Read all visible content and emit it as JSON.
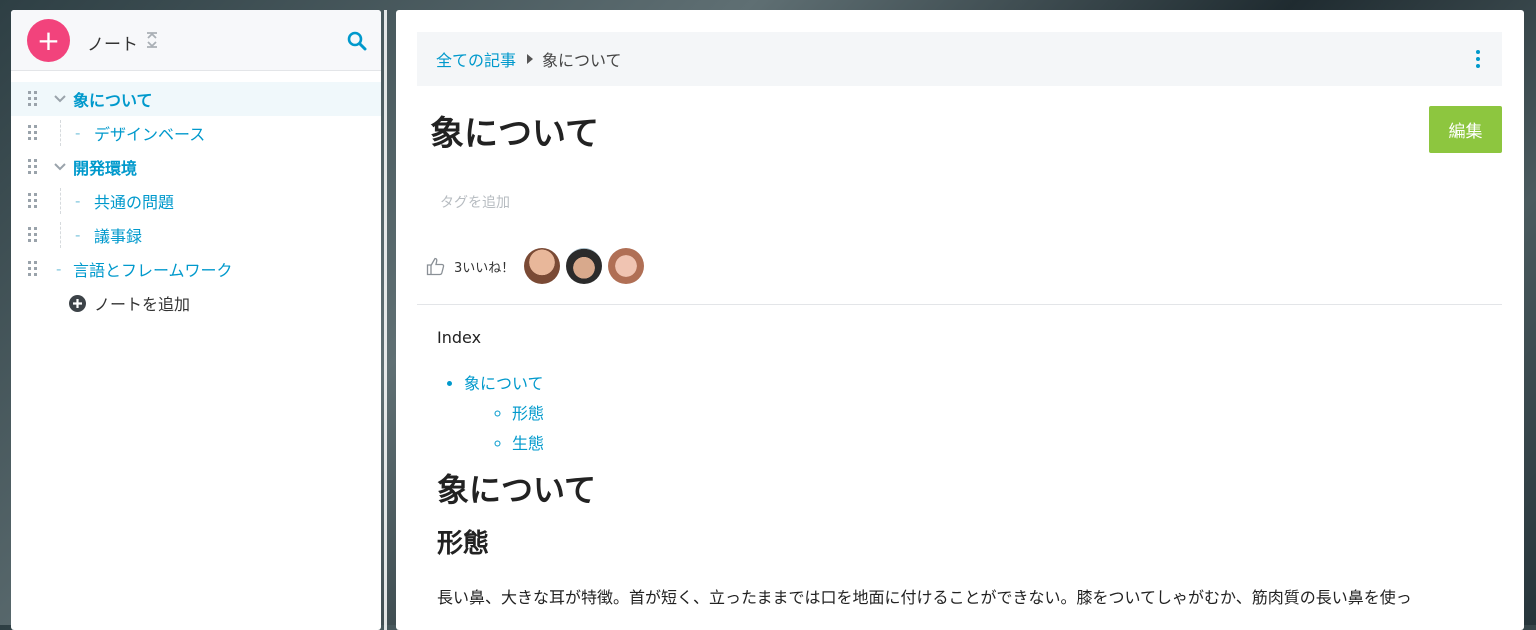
{
  "sidebar": {
    "add_label": "+",
    "title": "ノート",
    "tree": [
      {
        "label": "象について",
        "level": 0,
        "bold": true,
        "expanded": true,
        "active": true
      },
      {
        "label": "デザインベース",
        "level": 1,
        "bold": false
      },
      {
        "label": "開発環境",
        "level": 0,
        "bold": true,
        "expanded": true
      },
      {
        "label": "共通の問題",
        "level": 1,
        "bold": false
      },
      {
        "label": "議事録",
        "level": 1,
        "bold": false
      },
      {
        "label": "言語とフレームワーク",
        "level": 0,
        "bold": false
      }
    ],
    "add_note_label": "ノートを追加"
  },
  "breadcrumb": {
    "root": "全ての記事",
    "current": "象について"
  },
  "article": {
    "title": "象について",
    "edit_label": "編集",
    "tag_placeholder": "タグを追加",
    "likes_text": "3いいね！",
    "index_label": "Index",
    "toc": {
      "item": "象について",
      "children": [
        "形態",
        "生態"
      ]
    },
    "h1": "象について",
    "h2": "形態",
    "paragraph": "長い鼻、大きな耳が特徴。首が短く、立ったままでは口を地面に付けることができない。膝をついてしゃがむか、筋肉質の長い鼻を使っ"
  },
  "colors": {
    "accent": "#0099cc",
    "add_button": "#f2437c",
    "edit_button": "#8dc63f"
  },
  "icons": [
    "plus-icon",
    "collapse-icon",
    "search-icon",
    "drag-handle-icon",
    "chevron-down-icon",
    "plus-circle-icon",
    "caret-right-icon",
    "kebab-icon",
    "thumbs-up-icon"
  ]
}
